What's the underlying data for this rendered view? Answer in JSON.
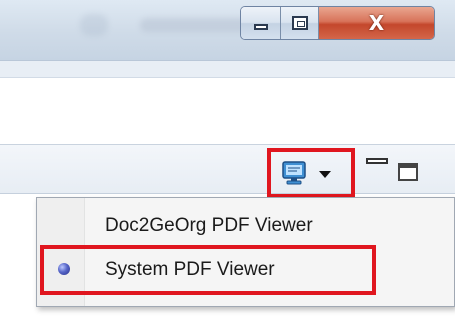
{
  "window": {
    "caption_buttons": {
      "minimize_icon": "minimize-icon",
      "maximize_icon": "restore-icon",
      "close_glyph": "X"
    }
  },
  "view_toolbar": {
    "viewer_button_icon": "monitor-icon",
    "dropdown_icon": "dropdown-arrow-icon",
    "minimize_icon": "minimize-view-icon",
    "maximize_icon": "maximize-view-icon"
  },
  "popup_menu": {
    "items": [
      {
        "label": "Doc2GeOrg PDF Viewer",
        "selected": false
      },
      {
        "label": "System PDF Viewer",
        "selected": true
      }
    ]
  },
  "colors": {
    "highlight": "#e0161f",
    "close_button": "#c4472c",
    "radio": "#3a46a8"
  }
}
